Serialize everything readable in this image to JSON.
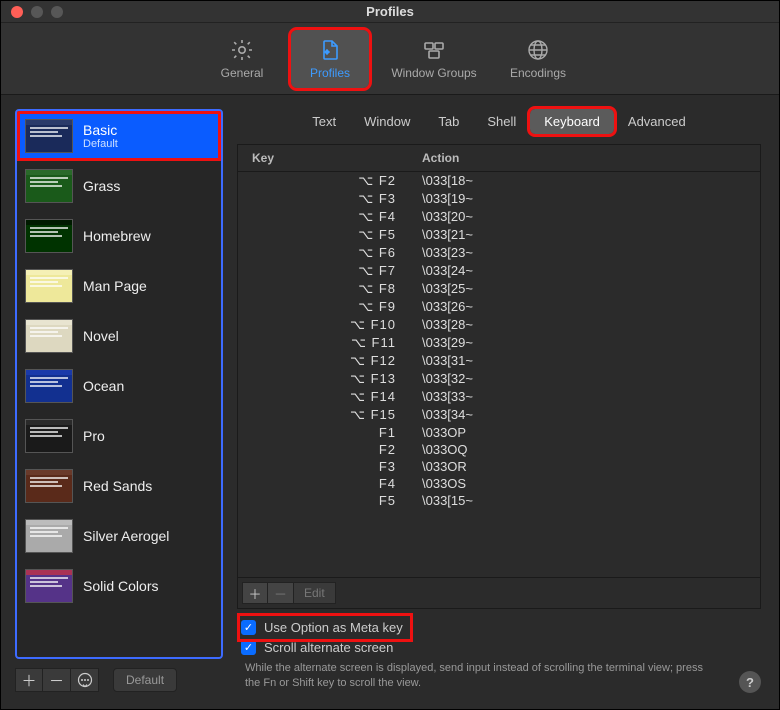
{
  "window": {
    "title": "Profiles"
  },
  "toolbar": {
    "general": "General",
    "profiles": "Profiles",
    "window_groups": "Window Groups",
    "encodings": "Encodings"
  },
  "sidebar": {
    "default_button": "Default",
    "profiles": [
      {
        "name": "Basic",
        "sub": "Default",
        "selected": true,
        "colors": [
          "#2a3a6a",
          "#1a2a5a"
        ]
      },
      {
        "name": "Grass",
        "colors": [
          "#2a6a2a",
          "#1a5a1a"
        ]
      },
      {
        "name": "Homebrew",
        "colors": [
          "#001a00",
          "#003300"
        ]
      },
      {
        "name": "Man Page",
        "colors": [
          "#f5f0b5",
          "#eee89a"
        ]
      },
      {
        "name": "Novel",
        "colors": [
          "#e8e4d0",
          "#ddd8c0"
        ]
      },
      {
        "name": "Ocean",
        "colors": [
          "#1a3aaa",
          "#123090"
        ]
      },
      {
        "name": "Pro",
        "colors": [
          "#2a2a2a",
          "#1a1a1a"
        ]
      },
      {
        "name": "Red Sands",
        "colors": [
          "#6a3a2a",
          "#5a2a1a"
        ]
      },
      {
        "name": "Silver Aerogel",
        "colors": [
          "#bcbcbc",
          "#aaaaaa"
        ]
      },
      {
        "name": "Solid Colors",
        "colors": [
          "#aa3355",
          "#553388"
        ]
      }
    ]
  },
  "sections": [
    "Text",
    "Window",
    "Tab",
    "Shell",
    "Keyboard",
    "Advanced"
  ],
  "table": {
    "headers": {
      "key": "Key",
      "action": "Action"
    },
    "edit_label": "Edit",
    "rows": [
      {
        "key": "⌥ F2",
        "action": "\\033[18~"
      },
      {
        "key": "⌥ F3",
        "action": "\\033[19~"
      },
      {
        "key": "⌥ F4",
        "action": "\\033[20~"
      },
      {
        "key": "⌥ F5",
        "action": "\\033[21~"
      },
      {
        "key": "⌥ F6",
        "action": "\\033[23~"
      },
      {
        "key": "⌥ F7",
        "action": "\\033[24~"
      },
      {
        "key": "⌥ F8",
        "action": "\\033[25~"
      },
      {
        "key": "⌥ F9",
        "action": "\\033[26~"
      },
      {
        "key": "⌥ F10",
        "action": "\\033[28~"
      },
      {
        "key": "⌥ F11",
        "action": "\\033[29~"
      },
      {
        "key": "⌥ F12",
        "action": "\\033[31~"
      },
      {
        "key": "⌥ F13",
        "action": "\\033[32~"
      },
      {
        "key": "⌥ F14",
        "action": "\\033[33~"
      },
      {
        "key": "⌥ F15",
        "action": "\\033[34~"
      },
      {
        "key": "F1",
        "action": "\\033OP"
      },
      {
        "key": "F2",
        "action": "\\033OQ"
      },
      {
        "key": "F3",
        "action": "\\033OR"
      },
      {
        "key": "F4",
        "action": "\\033OS"
      },
      {
        "key": "F5",
        "action": "\\033[15~"
      }
    ]
  },
  "options": {
    "option_as_meta": "Use Option as Meta key",
    "scroll_alternate": "Scroll alternate screen",
    "scroll_help": "While the alternate screen is displayed, send input instead of scrolling the terminal view; press the Fn or Shift key to scroll the view."
  }
}
